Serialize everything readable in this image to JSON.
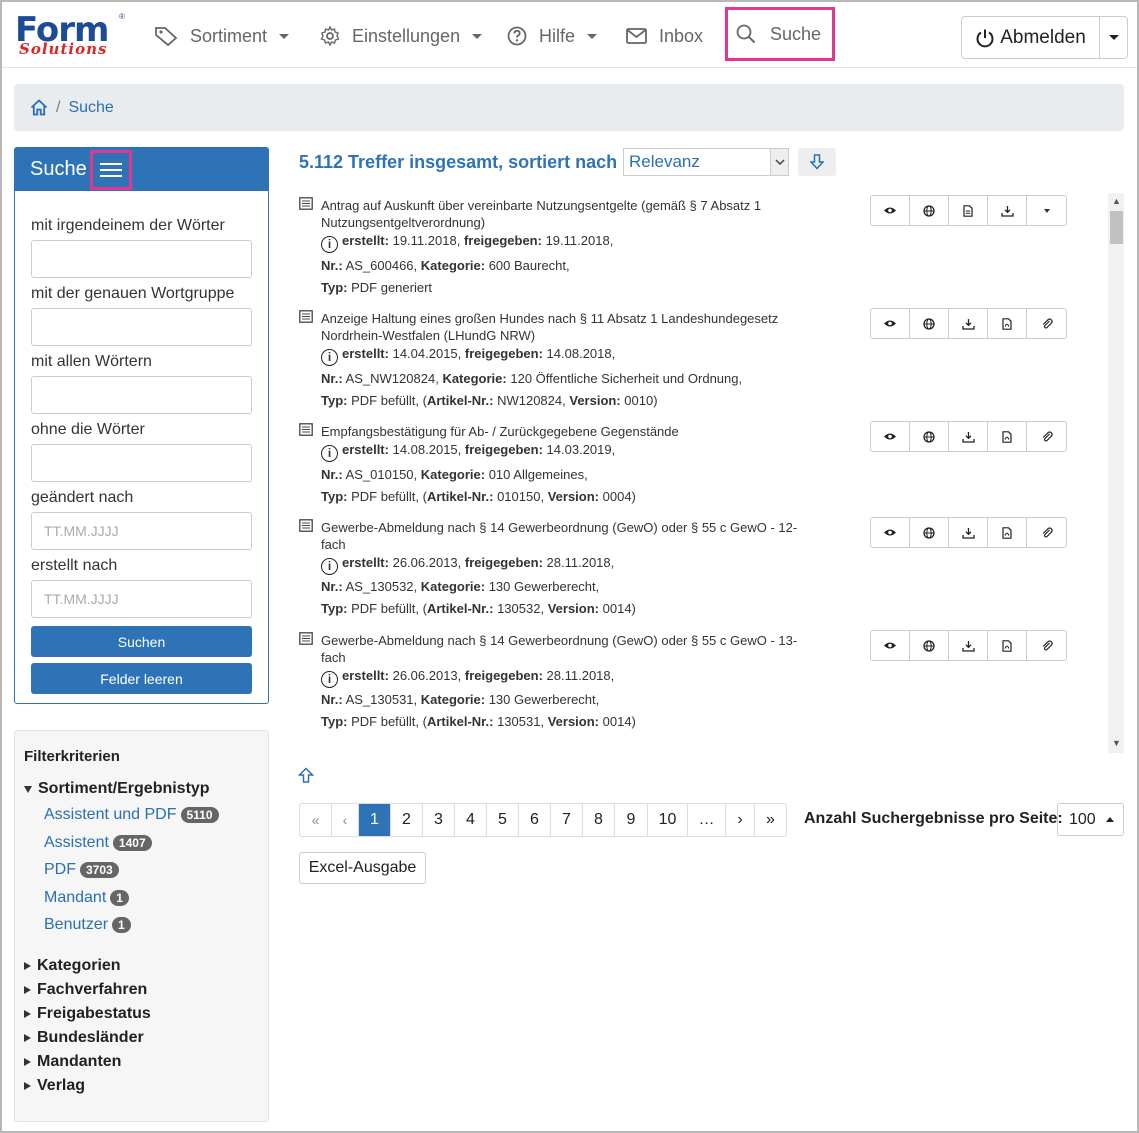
{
  "nav": {
    "logo_main": "Form",
    "logo_sub": "Solutions",
    "logo_reg": "®",
    "sortiment": "Sortiment",
    "einstellungen": "Einstellungen",
    "hilfe": "Hilfe",
    "inbox": "Inbox",
    "suche": "Suche",
    "abmelden": "Abmelden"
  },
  "breadcrumb": {
    "sep": "/",
    "current": "Suche"
  },
  "search_panel": {
    "title": "Suche",
    "label_any": "mit irgendeinem der Wörter",
    "label_exact": "mit der genauen Wortgruppe",
    "label_all": "mit allen Wörtern",
    "label_without": "ohne die Wörter",
    "label_changed": "geändert nach",
    "label_created": "erstellt nach",
    "date_placeholder": "TT.MM.JJJJ",
    "btn_search": "Suchen",
    "btn_clear": "Felder leeren"
  },
  "filters": {
    "title": "Filterkriterien",
    "group_open": "Sortiment/Ergebnistyp",
    "sub": [
      {
        "label": "Assistent und PDF",
        "count": "5110"
      },
      {
        "label": "Assistent",
        "count": "1407"
      },
      {
        "label": "PDF",
        "count": "3703"
      },
      {
        "label": "Mandant",
        "count": "1"
      },
      {
        "label": "Benutzer",
        "count": "1"
      }
    ],
    "groups": [
      "Kategorien",
      "Fachverfahren",
      "Freigabestatus",
      "Bundesländer",
      "Mandanten",
      "Verlag"
    ]
  },
  "results_header": {
    "summary": "5.112 Treffer insgesamt, sortiert nach",
    "sort_value": "Relevanz"
  },
  "labels": {
    "created": "erstellt:",
    "released": "freigegeben:",
    "nr": "Nr.:",
    "category": "Kategorie:",
    "type": "Typ:",
    "article": "Artikel-Nr.:",
    "version": "Version:"
  },
  "results": [
    {
      "title": "Antrag auf Auskunft über vereinbarte Nutzungsentgelte (gemäß § 7 Absatz 1 Nutzungsentgeltverordnung)",
      "created": "19.11.2018",
      "released": "19.11.2018",
      "nr": "AS_600466",
      "category": "600 Baurecht",
      "type": "PDF generiert",
      "article": "",
      "version": ""
    },
    {
      "title": "Anzeige Haltung eines großen Hundes nach § 11 Absatz 1 Landeshundegesetz Nordrhein-Westfalen (LHundG NRW)",
      "created": "14.04.2015",
      "released": "14.08.2018",
      "nr": "AS_NW120824",
      "category": "120 Öffentliche Sicherheit und Ordnung",
      "type": "PDF befüllt",
      "article": "NW120824",
      "version": "0010"
    },
    {
      "title": "Empfangsbestätigung für Ab- / Zurückgegebene Gegenstände",
      "created": "14.08.2015",
      "released": "14.03.2019",
      "nr": "AS_010150",
      "category": "010 Allgemeines",
      "type": "PDF befüllt",
      "article": "010150",
      "version": "0004"
    },
    {
      "title": "Gewerbe-Abmeldung nach § 14 Gewerbeordnung (GewO) oder § 55 c GewO - 12-fach",
      "created": "26.06.2013",
      "released": "28.11.2018",
      "nr": "AS_130532",
      "category": "130 Gewerberecht",
      "type": "PDF befüllt",
      "article": "130532",
      "version": "0014"
    },
    {
      "title": "Gewerbe-Abmeldung nach § 14 Gewerbeordnung (GewO) oder § 55 c GewO - 13-fach",
      "created": "26.06.2013",
      "released": "28.11.2018",
      "nr": "AS_130531",
      "category": "130 Gewerberecht",
      "type": "PDF befüllt",
      "article": "130531",
      "version": "0014"
    }
  ],
  "pagination": {
    "first": "«",
    "prev": "‹",
    "pages": [
      "1",
      "2",
      "3",
      "4",
      "5",
      "6",
      "7",
      "8",
      "9",
      "10"
    ],
    "ellipsis": "…",
    "next": "›",
    "last": "»",
    "per_page_label": "Anzahl Suchergebnisse pro Seite:",
    "per_page_value": "100"
  },
  "excel": "Excel-Ausgabe"
}
